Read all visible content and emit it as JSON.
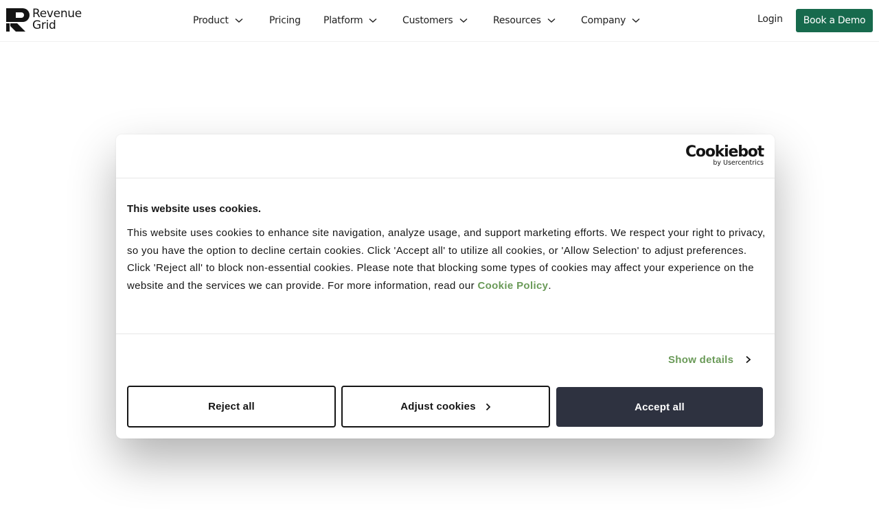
{
  "header": {
    "logo": {
      "line1": "Revenue",
      "line2": "Grid"
    },
    "nav": [
      {
        "label": "Product",
        "has_dropdown": true
      },
      {
        "label": "Pricing",
        "has_dropdown": false
      },
      {
        "label": "Platform",
        "has_dropdown": true
      },
      {
        "label": "Customers",
        "has_dropdown": true
      },
      {
        "label": "Resources",
        "has_dropdown": true
      },
      {
        "label": "Company",
        "has_dropdown": true
      }
    ],
    "login_label": "Login",
    "demo_label": "Book a Demo",
    "brand_color": "#176a4d"
  },
  "cookie_dialog": {
    "provider": {
      "name": "Cookiebot",
      "tagline": "by Usercentrics"
    },
    "title": "This website uses cookies.",
    "body": "This website uses cookies to enhance site navigation, analyze usage, and support marketing efforts. We respect your right to privacy, so you have the option to decline certain cookies. Click 'Accept all' to utilize all cookies, or 'Allow Selection' to adjust preferences. Click 'Reject all' to block non-essential cookies. Please note that blocking some types of cookies may affect your experience on the website and the services we can provide. For more information, read our",
    "policy_link": "Cookie Policy",
    "policy_suffix": ".",
    "show_details": "Show details",
    "buttons": {
      "reject": "Reject all",
      "adjust": "Adjust cookies",
      "accept": "Accept all"
    },
    "colors": {
      "link": "#6a9a58",
      "accept_bg": "#2e3240"
    }
  }
}
